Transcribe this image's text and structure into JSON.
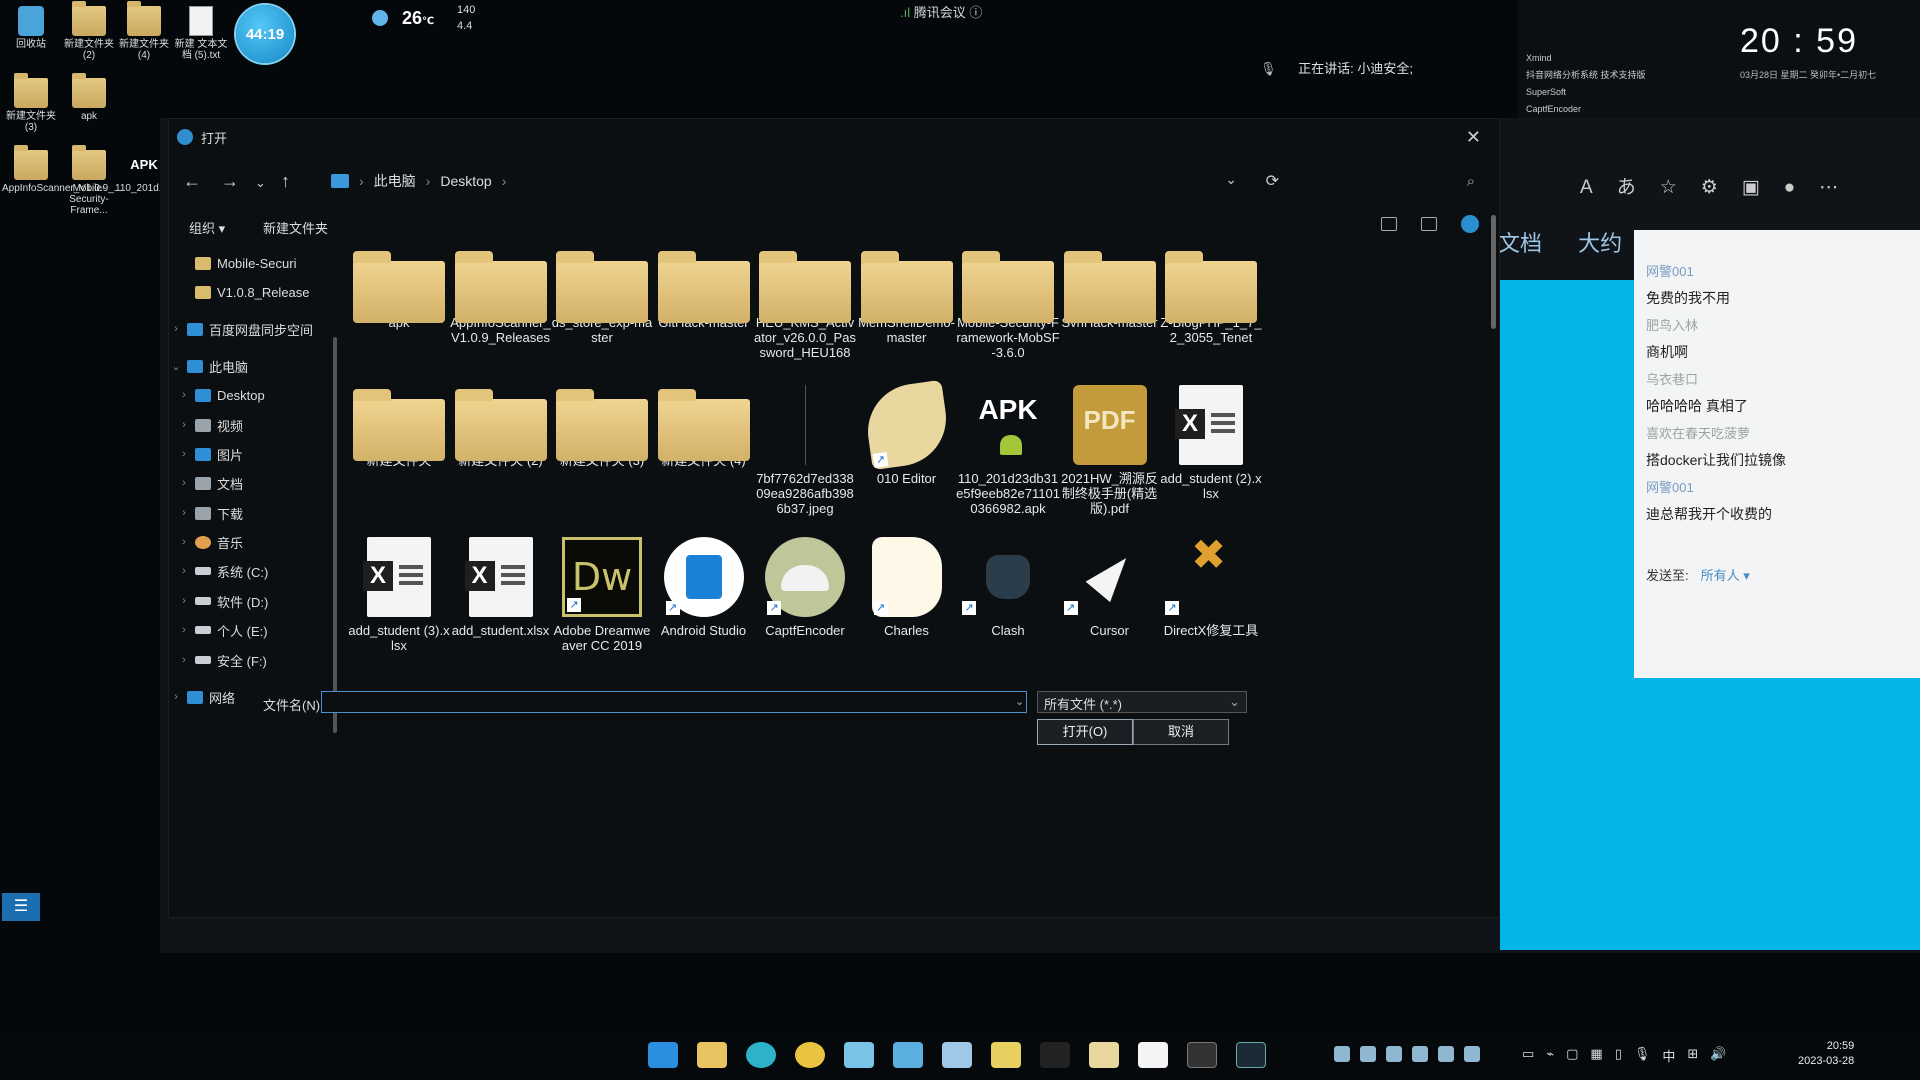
{
  "desktop": {
    "icons": [
      {
        "label": "回收站",
        "type": "recycle"
      },
      {
        "label": "新建文件夹 (2)",
        "type": "folder"
      },
      {
        "label": "新建文件夹 (4)",
        "type": "folder"
      },
      {
        "label": "新建 文本文档 (5).txt",
        "type": "text"
      },
      {
        "label": "新建文件夹 (3)",
        "type": "folder"
      },
      {
        "label": "apk",
        "type": "folder"
      },
      {
        "label": "AppInfoScanner_V1.0.9_...",
        "type": "folder"
      },
      {
        "label": "Mobile-Security-Frame...",
        "type": "folder"
      },
      {
        "label": "110_201d...db31e5f9...",
        "type": "apk"
      }
    ],
    "timer": "44:19",
    "weather": {
      "temp": "26",
      "unit": "℃",
      "up": "140",
      "down": "4.4"
    },
    "meeting_title": "腾讯会议",
    "speaking": "正在讲话: 小迪安全;",
    "right_apps": [
      "Xmind",
      "抖音网络分析系统 技术支持版",
      "SuperSoft",
      "CaptfEncoder"
    ],
    "clock": {
      "time": "20 : 59",
      "sub": "03月28日   星期二   癸卯年•二月初七"
    }
  },
  "browser": {
    "tabs": [
      "文档",
      "大约"
    ],
    "chat": {
      "messages": [
        {
          "name": "网警001",
          "text": "免费的我不用"
        },
        {
          "name": "肥鸟入林",
          "text": "商机啊"
        },
        {
          "name": "乌衣巷口",
          "text": "哈哈哈哈 真相了"
        },
        {
          "name": "喜欢在春天吃菠萝",
          "text": "搭docker让我们拉镜像"
        },
        {
          "name": "网警001",
          "text": "迪总帮我开个收费的"
        }
      ],
      "send_to_label": "发送至:",
      "send_to_value": "所有人"
    }
  },
  "dialog": {
    "title": "打开",
    "breadcrumb": [
      "此电脑",
      "Desktop"
    ],
    "toolbar": {
      "organize": "组织 ▾",
      "new_folder": "新建文件夹"
    },
    "sidebar": [
      {
        "label": "Mobile-Securi",
        "icon": "folder",
        "level": 1
      },
      {
        "label": "V1.0.8_Release",
        "icon": "folder",
        "level": 1
      },
      {
        "label": "百度网盘同步空间",
        "icon": "blue",
        "level": 0
      },
      {
        "label": "此电脑",
        "icon": "blue",
        "level": 0,
        "expanded": true
      },
      {
        "label": "Desktop",
        "icon": "blue",
        "level": 1
      },
      {
        "label": "视频",
        "icon": "gray",
        "level": 1
      },
      {
        "label": "图片",
        "icon": "blue",
        "level": 1
      },
      {
        "label": "文档",
        "icon": "gray",
        "level": 1
      },
      {
        "label": "下载",
        "icon": "gray",
        "level": 1
      },
      {
        "label": "音乐",
        "icon": "music",
        "level": 1
      },
      {
        "label": "系统 (C:)",
        "icon": "drive",
        "level": 1
      },
      {
        "label": "软件 (D:)",
        "icon": "drive",
        "level": 1
      },
      {
        "label": "个人 (E:)",
        "icon": "drive",
        "level": 1
      },
      {
        "label": "安全 (F:)",
        "icon": "drive",
        "level": 1
      },
      {
        "label": "网络",
        "icon": "blue",
        "level": 0
      }
    ],
    "files": [
      {
        "name": "apk",
        "kind": "folder"
      },
      {
        "name": "AppInfoScanner_V1.0.9_Releases",
        "kind": "folder"
      },
      {
        "name": "ds_store_exp-master",
        "kind": "folder"
      },
      {
        "name": "GitHack-master",
        "kind": "folder"
      },
      {
        "name": "HEU_KMS_Activator_v26.0.0_Password_HEU168",
        "kind": "folder"
      },
      {
        "name": "MemShellDemo-master",
        "kind": "folder"
      },
      {
        "name": "Mobile-Security-Framework-MobSF-3.6.0",
        "kind": "folder"
      },
      {
        "name": "SvnHack-master",
        "kind": "folder"
      },
      {
        "name": "Z-BlogPHP_1_7_2_3055_Tenet",
        "kind": "folder"
      },
      {
        "name": "新建文件夹",
        "kind": "folder"
      },
      {
        "name": "新建文件夹 (2)",
        "kind": "folder"
      },
      {
        "name": "新建文件夹 (3)",
        "kind": "folder"
      },
      {
        "name": "新建文件夹 (4)",
        "kind": "folder"
      },
      {
        "name": "7bf7762d7ed33809ea9286afb3986b37.jpeg",
        "kind": "jpeg"
      },
      {
        "name": "010 Editor",
        "kind": "feather",
        "shortcut": true
      },
      {
        "name": "110_201d23db31e5f9eeb82e711010366982.apk",
        "kind": "apk"
      },
      {
        "name": "2021HW_溯源反制终极手册(精选版).pdf",
        "kind": "pdf"
      },
      {
        "name": "add_student (2).xlsx",
        "kind": "xls"
      },
      {
        "name": "add_student (3).xlsx",
        "kind": "xls"
      },
      {
        "name": "add_student.xlsx",
        "kind": "xls"
      },
      {
        "name": "Adobe Dreamweaver CC 2019",
        "kind": "dw",
        "shortcut": true
      },
      {
        "name": "Android Studio",
        "kind": "as",
        "shortcut": true
      },
      {
        "name": "CaptfEncoder",
        "kind": "capt",
        "shortcut": true
      },
      {
        "name": "Charles",
        "kind": "charles",
        "shortcut": true
      },
      {
        "name": "Clash",
        "kind": "clash",
        "shortcut": true
      },
      {
        "name": "Cursor",
        "kind": "cursor",
        "shortcut": true
      },
      {
        "name": "DirectX修复工具",
        "kind": "dx",
        "shortcut": true
      }
    ],
    "filename_label": "文件名(N):",
    "filename_value": "",
    "filetype": "所有文件 (*.*)",
    "open_button": "打开(O)",
    "cancel_button": "取消"
  },
  "taskbar": {
    "ime": "中",
    "time": "20:59",
    "date": "2023-03-28"
  }
}
